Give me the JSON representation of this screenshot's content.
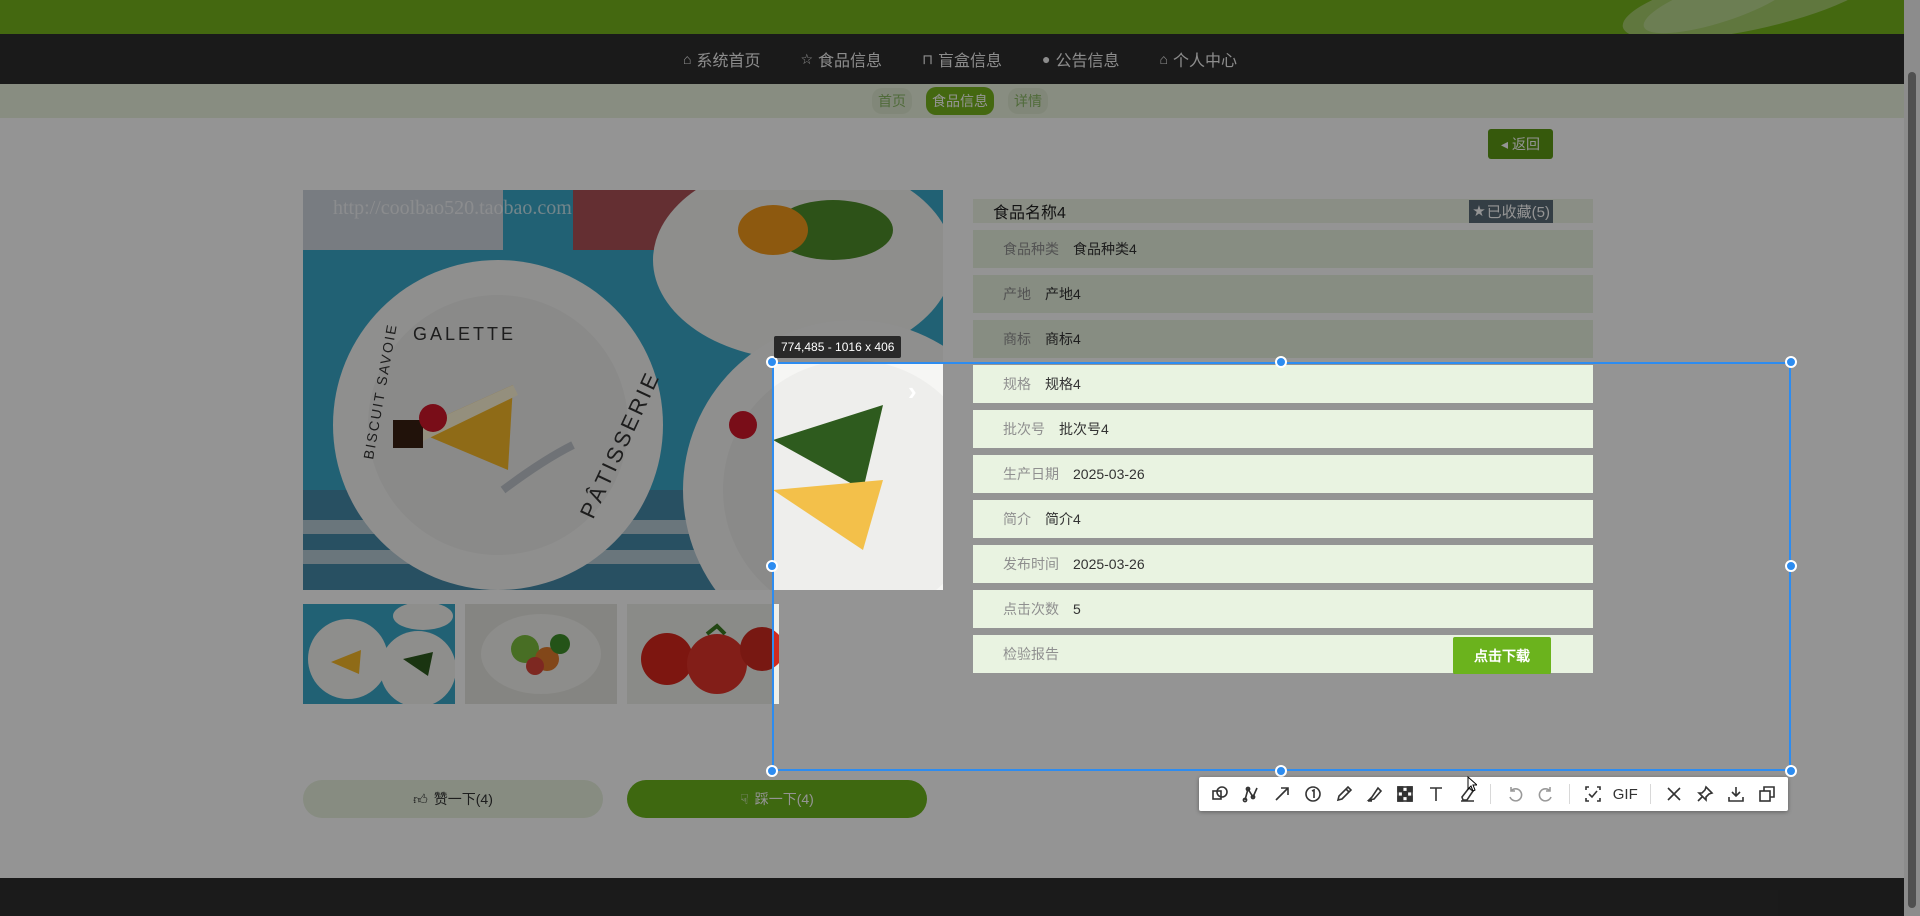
{
  "nav": {
    "items": [
      {
        "label": "系统首页",
        "icon": "home-icon"
      },
      {
        "label": "食品信息",
        "icon": "star-icon"
      },
      {
        "label": "盲盒信息",
        "icon": "bag-icon"
      },
      {
        "label": "公告信息",
        "icon": "info-circle-icon"
      },
      {
        "label": "个人中心",
        "icon": "home-icon"
      }
    ]
  },
  "breadcrumb": {
    "items": [
      "首页",
      "食品信息",
      "详情"
    ]
  },
  "back_label": "返回",
  "gallery": {
    "watermark": "http://coolbao520.taobao.com",
    "plate_text_1": "GALETTE",
    "plate_text_2": "BISCUIT SAVOIE",
    "plate_text_3": "PÂTISSERIE"
  },
  "product": {
    "title": "食品名称4",
    "favorite_label": "已收藏(5)",
    "fields": [
      {
        "label": "食品种类",
        "value": "食品种类4"
      },
      {
        "label": "产地",
        "value": "产地4"
      },
      {
        "label": "商标",
        "value": "商标4"
      },
      {
        "label": "规格",
        "value": "规格4"
      },
      {
        "label": "批次号",
        "value": "批次号4"
      },
      {
        "label": "生产日期",
        "value": "2025-03-26"
      },
      {
        "label": "简介",
        "value": "简介4"
      },
      {
        "label": "发布时间",
        "value": "2025-03-26"
      },
      {
        "label": "点击次数",
        "value": "5"
      }
    ],
    "report_label": "检验报告",
    "download_label": "点击下载"
  },
  "actions": {
    "like_label": "赞一下(4)",
    "dislike_label": "踩一下(4)"
  },
  "screenshot_tool": {
    "size_readout": "774,485 - 1016 x 406",
    "gif_label": "GIF",
    "selection_color": "#2d8cf0"
  },
  "colors": {
    "brand_green": "#75b31c",
    "dark_bar": "#2e2e2e"
  }
}
